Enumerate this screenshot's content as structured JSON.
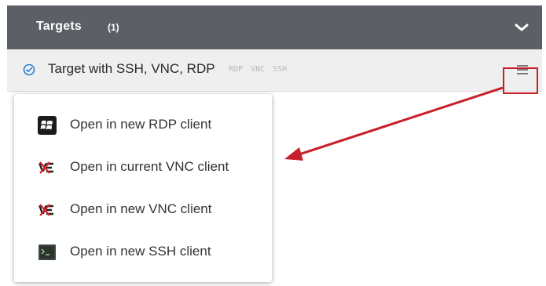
{
  "header": {
    "title": "Targets",
    "count": "(1)",
    "chevron_icon": "chevron-down-icon"
  },
  "target": {
    "name": "Target with SSH, VNC, RDP",
    "protocols": [
      "RDP",
      "VNC",
      "SSH"
    ],
    "status_icon": "check-circle-icon",
    "menu_icon": "hamburger-menu-icon"
  },
  "menu": {
    "items": [
      {
        "label": "Open in new RDP client",
        "icon": "windows-rdp-icon"
      },
      {
        "label": "Open in current VNC client",
        "icon": "vnc-icon"
      },
      {
        "label": "Open in new VNC client",
        "icon": "vnc-icon"
      },
      {
        "label": "Open in new SSH client",
        "icon": "terminal-icon"
      }
    ]
  },
  "colors": {
    "header_bg": "#5c6066",
    "row_bg": "#efefef",
    "accent_blue": "#2b7bd6",
    "annotation_red": "#c8202a"
  }
}
